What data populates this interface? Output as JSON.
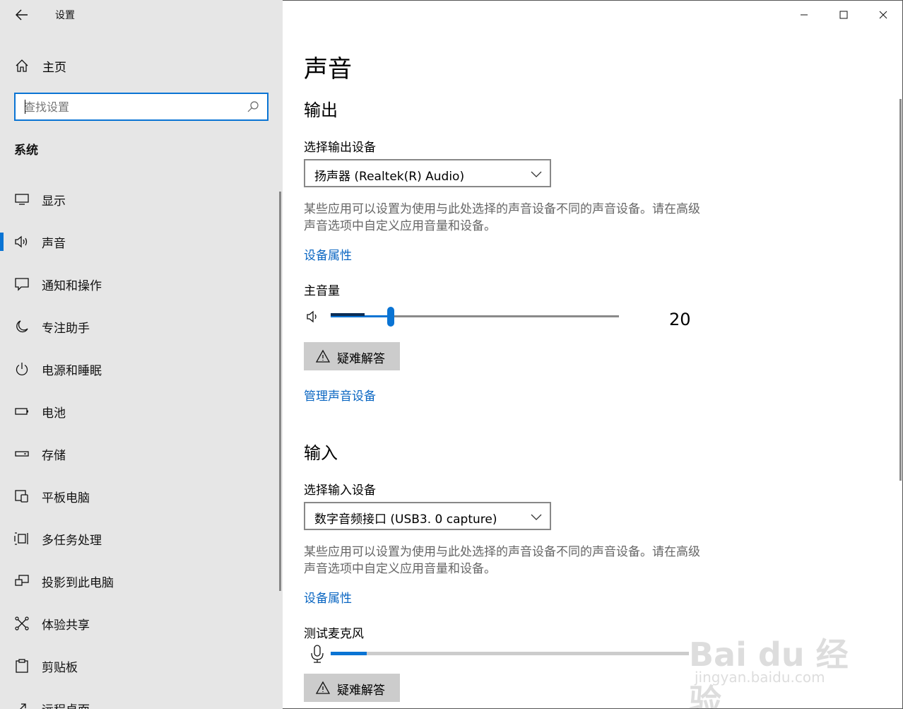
{
  "window": {
    "title": "设置",
    "back_icon": "arrow-left-icon",
    "minimize_icon": "minimize-icon",
    "maximize_icon": "maximize-icon",
    "close_icon": "close-icon"
  },
  "sidebar": {
    "home_label": "主页",
    "search_placeholder": "查找设置",
    "section_title": "系统",
    "items": [
      {
        "label": "显示",
        "icon": "monitor-icon",
        "active": false
      },
      {
        "label": "声音",
        "icon": "speaker-icon",
        "active": true
      },
      {
        "label": "通知和操作",
        "icon": "notification-icon",
        "active": false
      },
      {
        "label": "专注助手",
        "icon": "moon-icon",
        "active": false
      },
      {
        "label": "电源和睡眠",
        "icon": "power-icon",
        "active": false
      },
      {
        "label": "电池",
        "icon": "battery-icon",
        "active": false
      },
      {
        "label": "存储",
        "icon": "storage-icon",
        "active": false
      },
      {
        "label": "平板电脑",
        "icon": "tablet-icon",
        "active": false
      },
      {
        "label": "多任务处理",
        "icon": "multitask-icon",
        "active": false
      },
      {
        "label": "投影到此电脑",
        "icon": "project-icon",
        "active": false
      },
      {
        "label": "体验共享",
        "icon": "share-icon",
        "active": false
      },
      {
        "label": "剪贴板",
        "icon": "clipboard-icon",
        "active": false
      },
      {
        "label": "远程桌面",
        "icon": "remote-desktop-icon",
        "active": false
      }
    ]
  },
  "main": {
    "page_title": "声音",
    "output": {
      "heading": "输出",
      "select_label": "选择输出设备",
      "device": "扬声器 (Realtek(R) Audio)",
      "description": "某些应用可以设置为使用与此处选择的声音设备不同的声音设备。请在高级声音选项中自定义应用音量和设备。",
      "device_properties_link": "设备属性",
      "volume_label": "主音量",
      "volume_value": "20",
      "volume_fraction": 0.2,
      "troubleshoot_label": "疑难解答",
      "manage_devices_link": "管理声音设备"
    },
    "input": {
      "heading": "输入",
      "select_label": "选择输入设备",
      "device": "数字音频接口 (USB3. 0 capture)",
      "description": "某些应用可以设置为使用与此处选择的声音设备不同的声音设备。请在高级声音选项中自定义应用音量和设备。",
      "device_properties_link": "设备属性",
      "test_mic_label": "测试麦克风",
      "mic_level_fraction": 0.1,
      "troubleshoot_label": "疑难解答"
    }
  },
  "watermark": {
    "brand": "Bai du 经验",
    "url": "jingyan.baidu.com"
  },
  "colors": {
    "accent": "#0a74d4",
    "link": "#0a66c2",
    "sidebar_bg": "#e6e6e6",
    "button_bg": "#cccccc"
  }
}
